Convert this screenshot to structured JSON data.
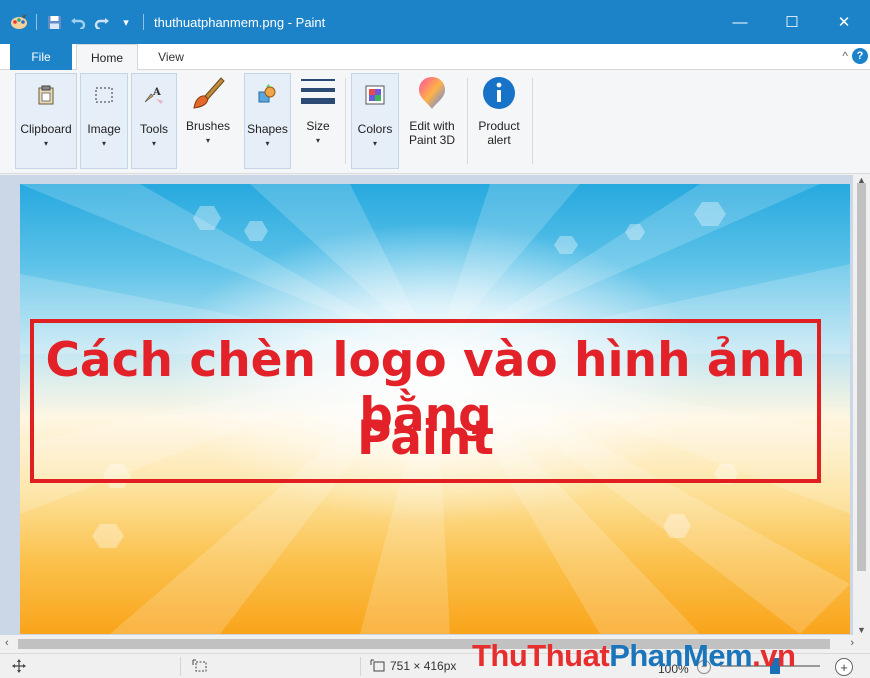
{
  "window": {
    "title": "thuthuatphanmem.png - Paint",
    "minimize": "—",
    "maximize": "☐",
    "close": "✕"
  },
  "tabs": {
    "file": "File",
    "home": "Home",
    "view": "View",
    "collapse": "^",
    "help": "?"
  },
  "ribbon": {
    "clipboard": "Clipboard",
    "image": "Image",
    "tools": "Tools",
    "brushes": "Brushes",
    "shapes": "Shapes",
    "size": "Size",
    "colors": "Colors",
    "edit_paint3d_1": "Edit with",
    "edit_paint3d_2": "Paint 3D",
    "product_alert_1": "Product",
    "product_alert_2": "alert",
    "caret": "▾"
  },
  "canvas": {
    "heading_line1": "Cách chèn logo vào hình ảnh bằng",
    "heading_line2": "Paint",
    "heading_color": "#e22228",
    "border_color": "#e02020"
  },
  "statusbar": {
    "image_size": "751 × 416px",
    "zoom": "100%",
    "zoom_in": "+",
    "zoom_out": "−"
  },
  "watermark": {
    "part1": "ThuThuat",
    "part2": "PhanMem",
    "part3": ".vn"
  },
  "colors": {
    "accent": "#1c83c9"
  }
}
